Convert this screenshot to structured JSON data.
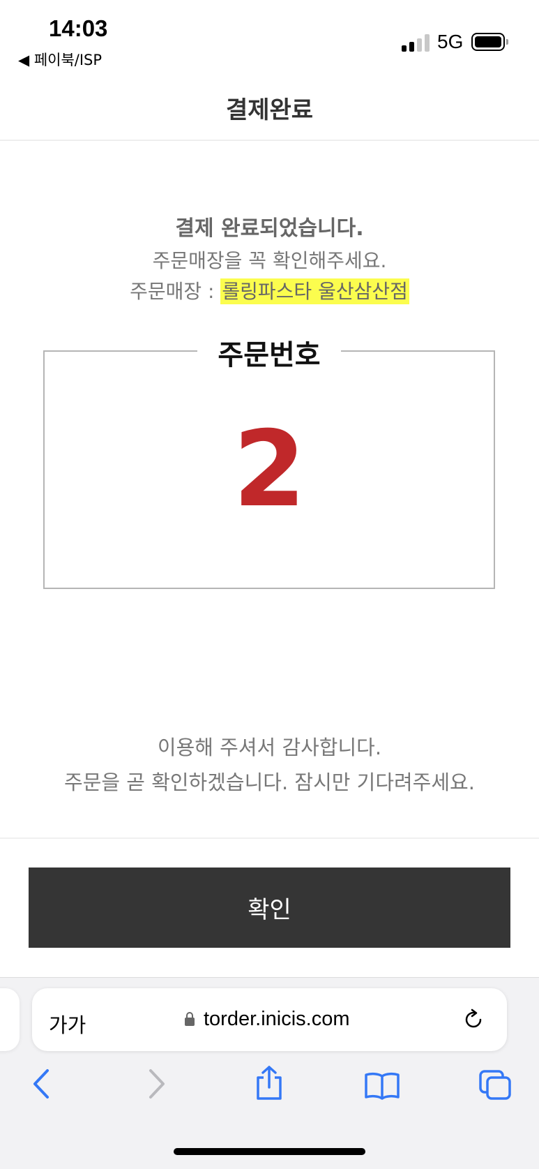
{
  "status_bar": {
    "time": "14:03",
    "back_app": "◀ 페이북/ISP",
    "network": "5G"
  },
  "header": {
    "title": "결제완료"
  },
  "message": {
    "main": "결제 완료되었습니다.",
    "sub": "주문매장을 꼭 확인해주세요.",
    "store_label": "주문매장 : ",
    "store_name": "롤링파스타 울산삼산점"
  },
  "order": {
    "label": "주문번호",
    "number": "2"
  },
  "thanks": {
    "line1": "이용해 주셔서 감사합니다.",
    "line2": "주문을 곧 확인하겠습니다. 잠시만 기다려주세요."
  },
  "confirm_button": {
    "label": "확인"
  },
  "browser": {
    "text_size_label": "가가",
    "url": "torder.inicis.com"
  },
  "colors": {
    "accent_red": "#c0282a",
    "highlight": "#fbfd4e",
    "button_bg": "#353535",
    "safari_blue": "#3478f6"
  },
  "icons": {
    "back": "chevron-left-icon",
    "forward": "chevron-right-icon",
    "share": "share-icon",
    "bookmarks": "book-icon",
    "tabs": "tabs-icon",
    "reload": "reload-icon",
    "lock": "lock-icon"
  }
}
